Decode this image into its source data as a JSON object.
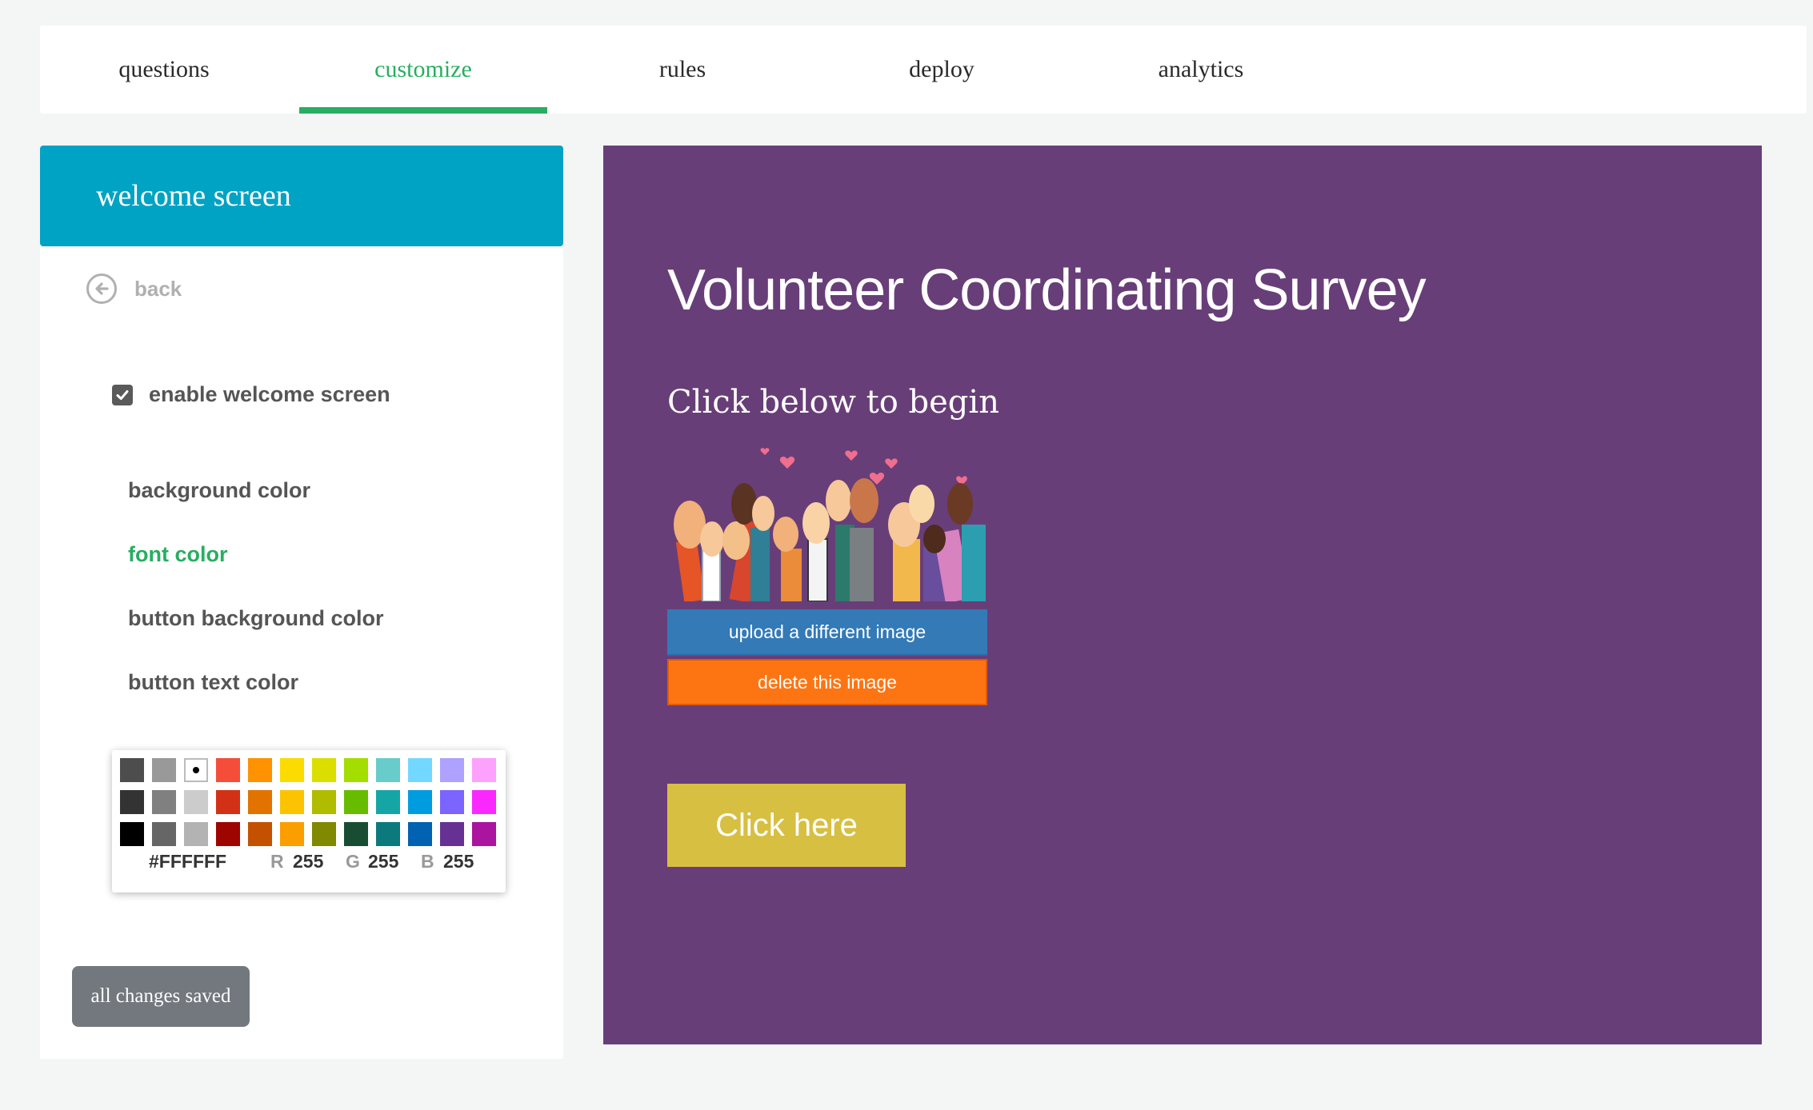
{
  "tabs": [
    {
      "label": "questions"
    },
    {
      "label": "customize",
      "active": true
    },
    {
      "label": "rules"
    },
    {
      "label": "deploy"
    },
    {
      "label": "analytics"
    }
  ],
  "sidebar": {
    "header": "welcome screen",
    "back_label": "back",
    "enable_label": "enable welcome screen",
    "enable_checked": true,
    "color_options": [
      {
        "label": "background color",
        "active": false
      },
      {
        "label": "font color",
        "active": true
      },
      {
        "label": "button background color",
        "active": false
      },
      {
        "label": "button text color",
        "active": false
      }
    ],
    "picker": {
      "swatches": [
        [
          "#4d4d4d",
          "#999999",
          "#ffffff",
          "#f44e3b",
          "#fe9200",
          "#fcdc00",
          "#dbdf00",
          "#a4dd00",
          "#68ccca",
          "#73d8ff",
          "#aea1ff",
          "#fda1ff"
        ],
        [
          "#333333",
          "#808080",
          "#cccccc",
          "#d33115",
          "#e27300",
          "#fcc400",
          "#b0bc00",
          "#68bc00",
          "#16a5a5",
          "#009ce0",
          "#7b64ff",
          "#fa28ff"
        ],
        [
          "#000000",
          "#666666",
          "#b3b3b3",
          "#9f0500",
          "#c45100",
          "#fb9e00",
          "#808900",
          "#194d33",
          "#0c797d",
          "#0062b1",
          "#653294",
          "#ab149e"
        ]
      ],
      "selected": "#ffffff",
      "hex": "#FFFFFF",
      "r_label": "R",
      "r": "255",
      "g_label": "G",
      "g": "255",
      "b_label": "B",
      "b": "255"
    },
    "save_status": "all changes saved"
  },
  "preview": {
    "background": "#683e79",
    "title": "Volunteer Coordinating Survey",
    "subtitle": "Click below to begin",
    "upload_button": "upload a different image",
    "delete_button": "delete this image",
    "cta_label": "Click here",
    "cta_color": "#d7bf42"
  }
}
